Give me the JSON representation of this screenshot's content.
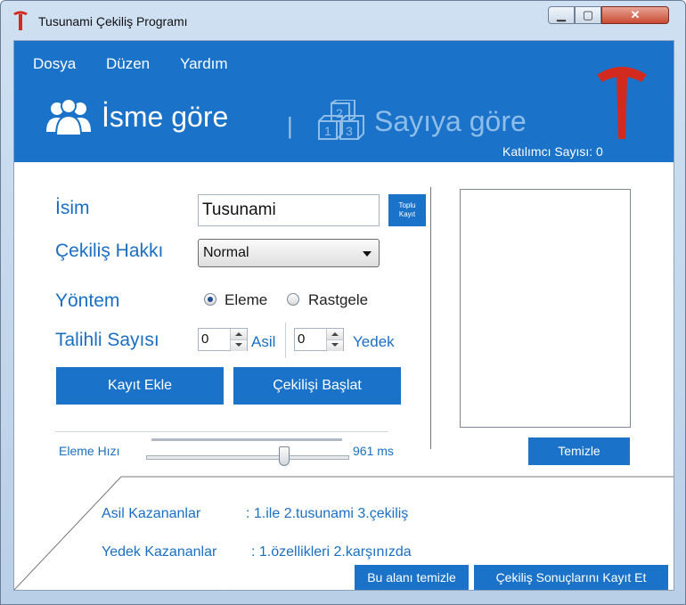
{
  "window": {
    "title": "Tusunami Çekiliş Programı",
    "close_glyph": "✕",
    "min_glyph": "▁",
    "max_glyph": "▢"
  },
  "menu": {
    "items": [
      "Dosya",
      "Düzen",
      "Yardım"
    ]
  },
  "header": {
    "tab_name": "İsme göre",
    "separator": "|",
    "tab_number": "Sayıya göre",
    "participant_count": "Katılımcı Sayısı: 0",
    "active_color": "#1a73c9"
  },
  "form": {
    "name_label": "İsim",
    "name_value": "Tusunami",
    "bulk_button_line1": "Toplu",
    "bulk_button_line2": "Kayıt",
    "right_label": "Çekiliş Hakkı",
    "right_value": "Normal",
    "method_label": "Yöntem",
    "method_options": [
      "Eleme",
      "Rastgele"
    ],
    "method_selected": "Eleme",
    "lucky_label": "Talihli Sayısı",
    "main_count": "0",
    "main_label": "Asil",
    "reserve_count": "0",
    "reserve_label": "Yedek",
    "add_button": "Kayıt Ekle",
    "start_button": "Çekilişi Başlat",
    "speed_label": "Eleme Hızı",
    "speed_value": "961 ms"
  },
  "list": {
    "clear_button": "Temizle"
  },
  "results": {
    "main_winners_label": "Asil Kazananlar",
    "main_winners_value": ": 1.ile 2.tusunami 3.çekiliş",
    "reserve_winners_label": "Yedek Kazananlar",
    "reserve_winners_value": ": 1.özellikleri 2.karşınızda",
    "clear_area_button": "Bu alanı temizle",
    "save_results_button": "Çekiliş Sonuçlarını Kayıt Et"
  }
}
